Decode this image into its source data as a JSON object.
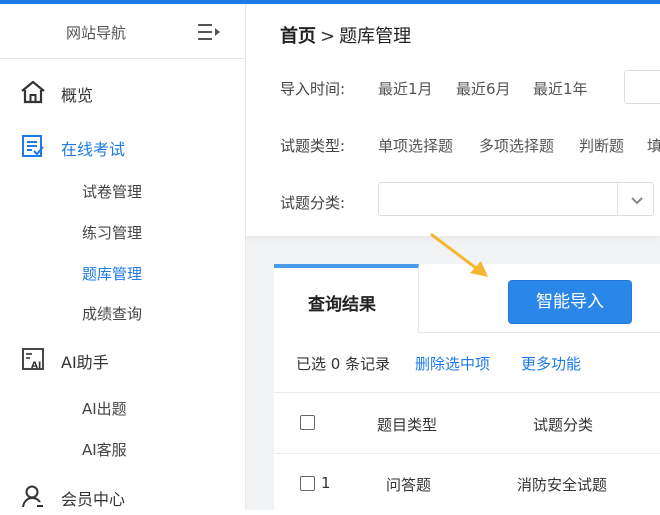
{
  "sidebar": {
    "title": "网站导航",
    "menu_icon": "menu-collapse-icon",
    "items": [
      {
        "label": "概览",
        "icon": "home-icon"
      },
      {
        "label": "在线考试",
        "icon": "exam-list-icon"
      },
      {
        "label": "AI助手",
        "icon": "ai-icon"
      },
      {
        "label": "会员中心",
        "icon": "user-icon"
      }
    ],
    "exam_sub": [
      "试卷管理",
      "练习管理",
      "题库管理",
      "成绩查询"
    ],
    "ai_sub": [
      "AI出题",
      "AI客服"
    ]
  },
  "breadcrumb": {
    "home": "首页",
    "separator": ">",
    "current": "题库管理"
  },
  "filters": {
    "import_time": {
      "label": "导入时间:",
      "options": [
        "最近1月",
        "最近6月",
        "最近1年"
      ]
    },
    "question_type": {
      "label": "试题类型:",
      "options": [
        "单项选择题",
        "多项选择题",
        "判断题",
        "填"
      ]
    },
    "category": {
      "label": "试题分类:",
      "value": ""
    }
  },
  "results": {
    "tab_label": "查询结果",
    "import_button": "智能导入",
    "selected_text": "已选 0 条记录",
    "delete_link": "删除选中项",
    "more_link": "更多功能",
    "columns": [
      "题目类型",
      "试题分类"
    ],
    "rows": [
      {
        "index": "1",
        "type": "问答题",
        "category": "消防安全试题"
      }
    ]
  },
  "colors": {
    "accent": "#1e7be6",
    "button": "#2a86e8",
    "arrow": "#f5b731"
  }
}
